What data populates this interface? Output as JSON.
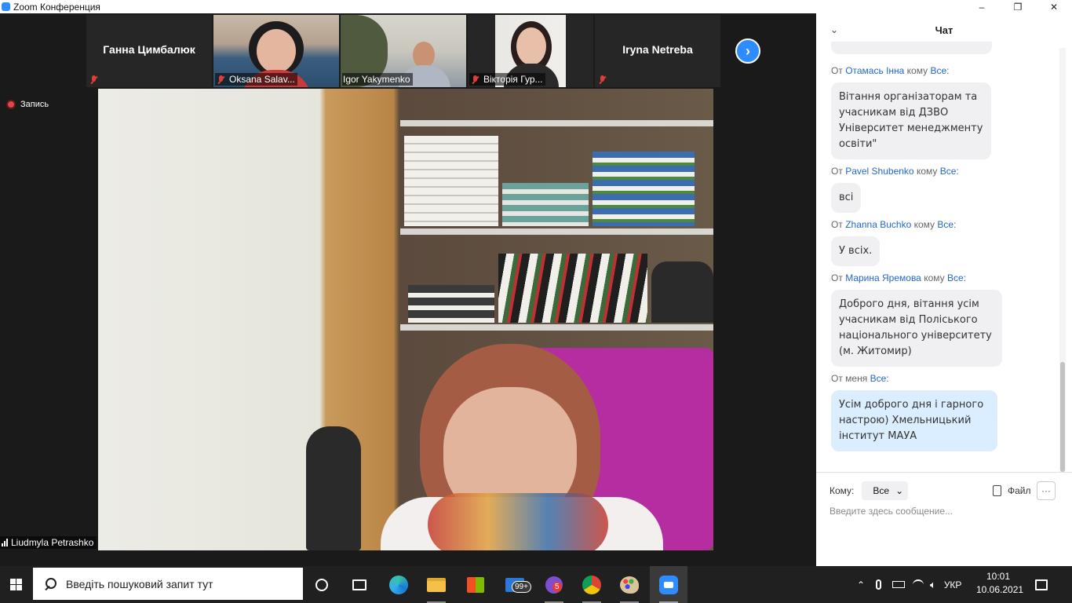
{
  "window": {
    "title": "Zoom Конференция",
    "controls": [
      "–",
      "❐",
      "✕"
    ]
  },
  "participants": [
    {
      "name": "Ганна Цимбалюк",
      "video": false,
      "muted": true
    },
    {
      "name": "Oksana Salav...",
      "video": true,
      "muted": true
    },
    {
      "name": "Igor Yakymenko",
      "video": true,
      "muted": false
    },
    {
      "name": "Вікторія Гур...",
      "video": true,
      "muted": true
    },
    {
      "name": "Iryna Netreba",
      "video": false,
      "muted": true
    }
  ],
  "recording": {
    "label": "Запись"
  },
  "speaker": {
    "name": "Liudmyla Petrashko"
  },
  "chat": {
    "title": "Чат",
    "from_word": "От",
    "to_word": "кому",
    "me_label": "От меня",
    "messages": [
      {
        "sender": "Отамась Інна",
        "to": "Все:",
        "text": "Вітання організаторам та учасникам  від ДЗВО Університет менеджменту освіти\"",
        "mine": false
      },
      {
        "sender": "Pavel Shubenko",
        "to": "Все:",
        "text": "всі",
        "mine": false
      },
      {
        "sender": "Zhanna Buchko",
        "to": "Все:",
        "text": "У всіх.",
        "mine": false
      },
      {
        "sender": "Марина Яремова",
        "to": "Все:",
        "text": "Доброго дня, вітання усім учасникам від Поліського національного університету (м. Житомир)",
        "mine": false
      },
      {
        "sender": "",
        "to": "Все:",
        "text": "Усім доброго дня і гарного настрою) Хмельницький інститут МАУА",
        "mine": true
      }
    ],
    "to_label": "Кому:",
    "to_value": "Все",
    "file_label": "Файл",
    "more_label": "···",
    "input_placeholder": "Введите здесь сообщение..."
  },
  "taskbar": {
    "search_placeholder": "Введіть пошуковий запит тут",
    "mail_badge": "99+",
    "viber_badge": "5",
    "language": "УКР",
    "time": "10:01",
    "date": "10.06.2021"
  },
  "colors": {
    "accent": "#2d8cff",
    "mute": "#e03c3c",
    "chat_link": "#2468cc",
    "my_bubble": "#dbeeff"
  }
}
